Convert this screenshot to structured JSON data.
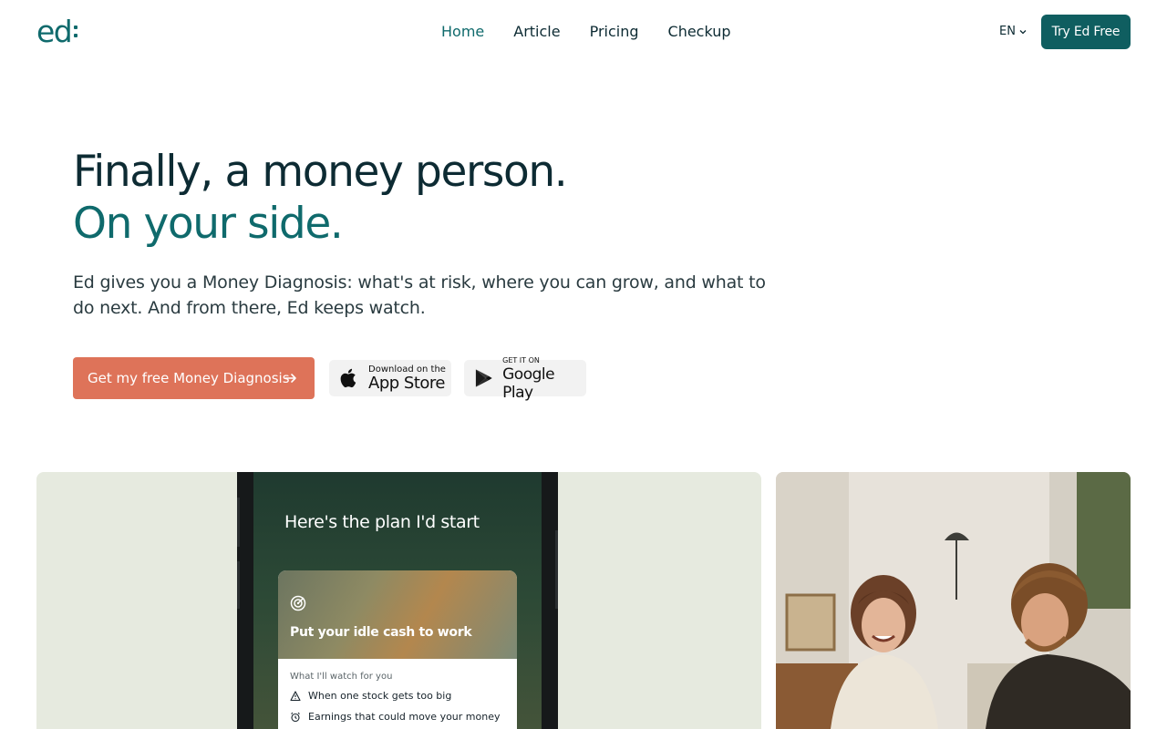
{
  "brand": {
    "logo_text": "ed"
  },
  "nav": {
    "links": [
      {
        "label": "Home",
        "active": true
      },
      {
        "label": "Article",
        "active": false
      },
      {
        "label": "Pricing",
        "active": false
      },
      {
        "label": "Checkup",
        "active": false
      }
    ],
    "language": "EN",
    "try_button": "Try Ed Free"
  },
  "hero": {
    "title_line1": "Finally, a money person.",
    "title_line2": "On your side.",
    "subtitle": "Ed gives you a Money Diagnosis: what's at risk, where you can grow, and what to do next. And from there, Ed keeps watch.",
    "cta_label": "Get my free Money Diagnosis",
    "app_store": {
      "small": "Download on the",
      "big": "App Store"
    },
    "google_play": {
      "small": "GET IT ON",
      "big": "Google Play"
    }
  },
  "phone_preview": {
    "headline": "Here's the plan I'd start",
    "card_title": "Put your idle cash to work",
    "watch_label": "What I'll watch for you",
    "watch_items": [
      {
        "icon": "warning-icon",
        "text": "When one stock gets too big"
      },
      {
        "icon": "alarm-icon",
        "text": "Earnings that could move your money"
      }
    ]
  },
  "colors": {
    "brand_teal": "#0f6a6c",
    "cta_coral": "#de7359",
    "dark_text": "#0d2b33"
  }
}
